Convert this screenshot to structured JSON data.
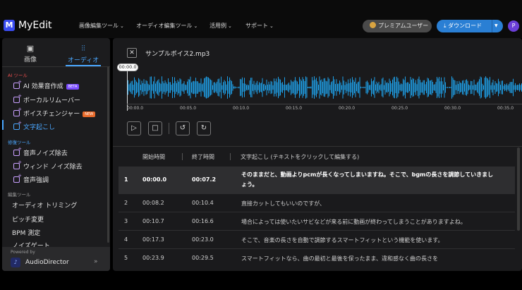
{
  "app": {
    "logo_letter": "M",
    "name": "MyEdit"
  },
  "nav": [
    {
      "label": "画像編集ツール"
    },
    {
      "label": "オーディオ編集ツール"
    },
    {
      "label": "活用例"
    },
    {
      "label": "サポート"
    }
  ],
  "header": {
    "premium_label": "プレミアムユーザー",
    "download_label": "ダウンロード",
    "avatar_letter": "P"
  },
  "sidebar": {
    "tabs": [
      {
        "label": "画像"
      },
      {
        "label": "オーディオ"
      }
    ],
    "active_tab": "オーディオ",
    "sections": [
      {
        "title": "AI ツール",
        "color": "#e84d4d"
      },
      {
        "title": "修復ツール",
        "color": "#4aa7ff"
      },
      {
        "title": "編集ツール",
        "color": "#9a9a9a"
      }
    ],
    "ai_items": [
      {
        "label": "AI 効果音作成",
        "badge": "BETA",
        "badge_color": "#7b4dff"
      },
      {
        "label": "ボーカルリムーバー"
      },
      {
        "label": "ボイスチェンジャー",
        "badge": "NEW",
        "badge_color": "#e86a2a"
      },
      {
        "label": "文字起こし"
      }
    ],
    "repair_items": [
      {
        "label": "音声ノイズ除去"
      },
      {
        "label": "ウィンド ノイズ除去"
      },
      {
        "label": "音声強調"
      }
    ],
    "edit_items": [
      {
        "label": "オーディオ トリミング"
      },
      {
        "label": "ピッチ変更"
      },
      {
        "label": "BPM 測定"
      },
      {
        "label": "ノイズゲート"
      }
    ],
    "powered_by": "Powered by",
    "powered_app": "AudioDirector"
  },
  "editor": {
    "filename": "サンプルボイス2.mp3",
    "current_time": "00:00.0",
    "ruler_labels": [
      "00:00.0",
      "00:05.0",
      "00:10.0",
      "00:15.0",
      "00:20.0",
      "00:25.0",
      "00:30.0",
      "00:35.0"
    ],
    "waveform_color": "#1ea0e8"
  },
  "table": {
    "headers": {
      "start": "開始時間",
      "end": "終了時間",
      "text": "文字起こし (テキストをクリックして編集する)"
    },
    "rows": [
      {
        "no": "1",
        "start": "00:00.0",
        "end": "00:07.2",
        "text1": "そのままだと、動画よりpcmが長くなってしまいますね。そこで、bgmの長さを調節していきまし",
        "text2": "ょう。",
        "selected": true
      },
      {
        "no": "2",
        "start": "00:08.2",
        "end": "00:10.4",
        "text1": "直接カットしてもいいのですが、"
      },
      {
        "no": "3",
        "start": "00:10.7",
        "end": "00:16.6",
        "text1": "場合によっては使いたいサビなどが来る前に動画が終わってしまうことがありますよね。"
      },
      {
        "no": "4",
        "start": "00:17.3",
        "end": "00:23.0",
        "text1": "そこで、音楽の長さを自動で調節するスマートフィットという機能を使います。"
      },
      {
        "no": "5",
        "start": "00:23.9",
        "end": "00:29.5",
        "text1": "スマートフィットなら、曲の最初と最後を保ったまま、違和感なく曲の長さを"
      }
    ]
  }
}
